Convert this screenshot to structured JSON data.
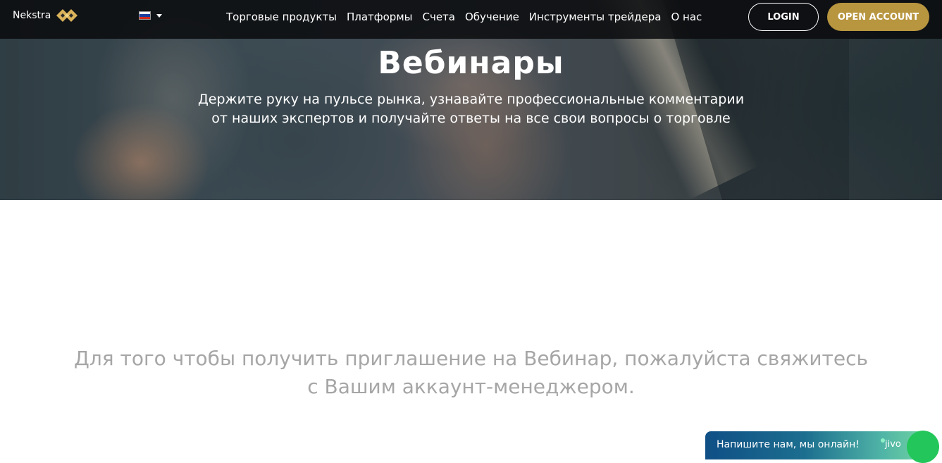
{
  "brand": {
    "name": "Nekstra",
    "logo_color": "#d9b25a"
  },
  "language": {
    "selected": "Russian",
    "flag_colors": [
      "#ffffff",
      "#1c3f9e",
      "#d52b1e"
    ]
  },
  "nav": {
    "items": [
      {
        "label": "Торговые продукты"
      },
      {
        "label": "Платформы"
      },
      {
        "label": "Счета"
      },
      {
        "label": "Обучение"
      },
      {
        "label": "Инструменты трейдера"
      },
      {
        "label": "О нас"
      }
    ],
    "login_label": "LOGIN",
    "open_account_label": "OPEN ACCOUNT",
    "accent_color": "#b8953f"
  },
  "hero": {
    "title": "Вебинары",
    "subtitle_line1": "Держите руку на пульсе рынка, узнавайте профессиональные комментарии",
    "subtitle_line2": "от наших экспертов и получайте ответы на все свои вопросы о торговле"
  },
  "main": {
    "invite_line1": "Для того чтобы получить приглашение на Вебинар, пожалуйста свяжитесь",
    "invite_line2": "с Вашим аккаунт-менеджером."
  },
  "chat": {
    "label": "Напишите нам, мы онлайн!",
    "brand": "jivo"
  }
}
